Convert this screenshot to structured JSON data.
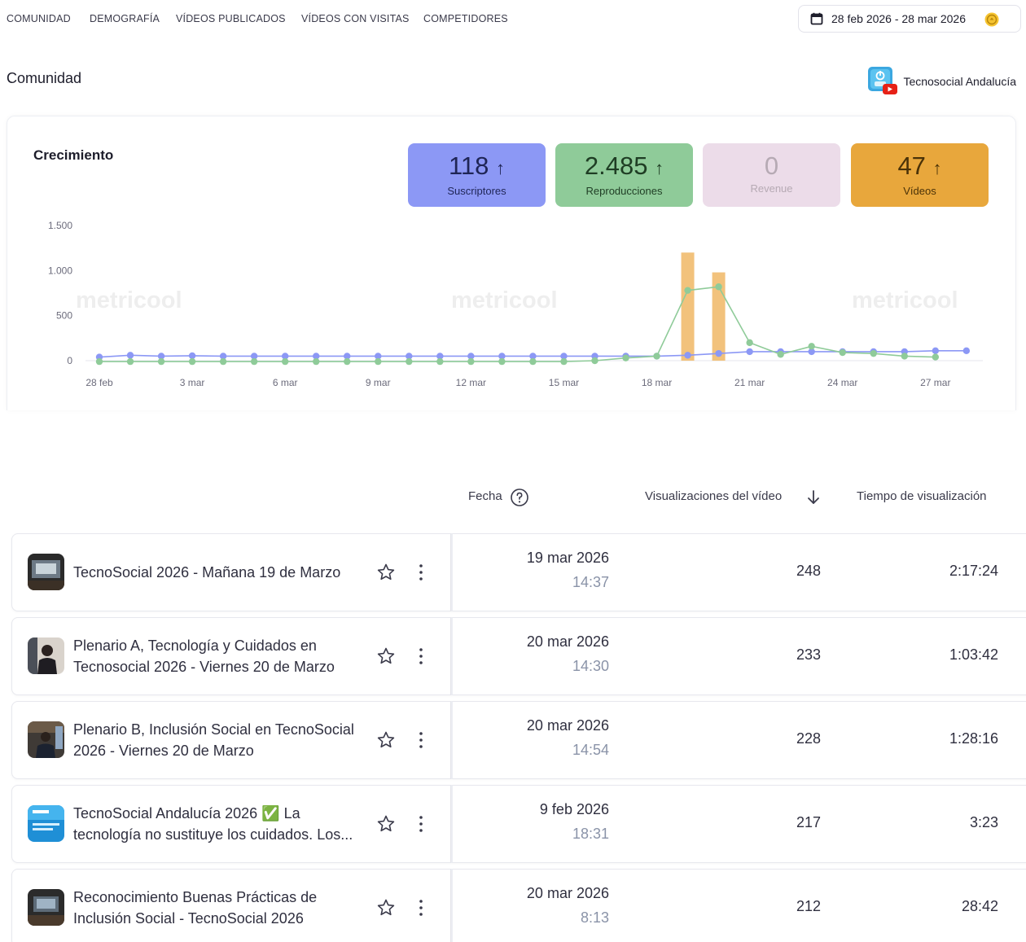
{
  "nav": {
    "tabs": [
      {
        "label": "COMUNIDAD"
      },
      {
        "label": "DEMOGRAFÍA"
      },
      {
        "label": "VÍDEOS PUBLICADOS"
      },
      {
        "label": "VÍDEOS CON VISITAS"
      },
      {
        "label": "COMPETIDORES"
      }
    ],
    "date_range": "28 feb 2026 - 28 mar 2026"
  },
  "section": {
    "title": "Comunidad",
    "account_name": "Tecnosocial Andalucía"
  },
  "growth": {
    "title": "Crecimiento",
    "kpis": [
      {
        "value": "118",
        "label": "Suscriptores",
        "trend": "up",
        "color": "#8c98f5"
      },
      {
        "value": "2.485",
        "label": "Reproducciones",
        "trend": "up",
        "color": "#8fcb99"
      },
      {
        "value": "0",
        "label": "Revenue",
        "trend": "none",
        "color": "#ecdce9"
      },
      {
        "value": "47",
        "label": "Vídeos",
        "trend": "up",
        "color": "#e8a73c"
      }
    ],
    "watermark": "metricool"
  },
  "chart_data": {
    "type": "line",
    "x_tick_labels": [
      "28 feb",
      "3 mar",
      "6 mar",
      "9 mar",
      "12 mar",
      "15 mar",
      "18 mar",
      "21 mar",
      "24 mar",
      "27 mar"
    ],
    "y_ticks": [
      "0",
      "500",
      "1.000",
      "1.500"
    ],
    "ylim": [
      0,
      1500
    ],
    "x_count": 29,
    "series": [
      {
        "color": "#8c98f5",
        "values": [
          40,
          60,
          50,
          55,
          50,
          50,
          50,
          50,
          50,
          50,
          50,
          50,
          50,
          50,
          50,
          50,
          50,
          50,
          50,
          60,
          80,
          100,
          100,
          100,
          100,
          100,
          100,
          110,
          110
        ]
      },
      {
        "color": "#8fcb99",
        "values": [
          -10,
          -10,
          -10,
          -10,
          -10,
          -10,
          -10,
          -10,
          -10,
          -10,
          -10,
          -10,
          -10,
          -10,
          -10,
          -10,
          0,
          30,
          50,
          780,
          820,
          200,
          70,
          160,
          90,
          80,
          50,
          40,
          null
        ]
      },
      {
        "color": "#f2c27c",
        "bars": [
          {
            "index": 19,
            "value": 1200
          },
          {
            "index": 20,
            "value": 980
          }
        ]
      }
    ]
  },
  "table": {
    "headers": {
      "date": "Fecha",
      "views": "Visualizaciones del vídeo",
      "watch_time": "Tiempo de visualización"
    },
    "rows": [
      {
        "title": "TecnoSocial 2026 - Mañana 19 de Marzo",
        "date": "19 mar 2026",
        "time": "14:37",
        "views": "248",
        "watch": "2:17:24"
      },
      {
        "title": "Plenario A, Tecnología y Cuidados en Tecnosocial 2026 - Viernes 20 de Marzo",
        "date": "20 mar 2026",
        "time": "14:30",
        "views": "233",
        "watch": "1:03:42"
      },
      {
        "title": "Plenario B, Inclusión Social en TecnoSocial 2026 - Viernes 20 de Marzo",
        "date": "20 mar 2026",
        "time": "14:54",
        "views": "228",
        "watch": "1:28:16"
      },
      {
        "title": "TecnoSocial Andalucía 2026 ✅ La tecnología no sustituye los cuidados. Los...",
        "date": "9 feb 2026",
        "time": "18:31",
        "views": "217",
        "watch": "3:23"
      },
      {
        "title": "Reconocimiento Buenas Prácticas de Inclusión Social - TecnoSocial 2026",
        "date": "20 mar 2026",
        "time": "8:13",
        "views": "212",
        "watch": "28:42"
      }
    ]
  }
}
